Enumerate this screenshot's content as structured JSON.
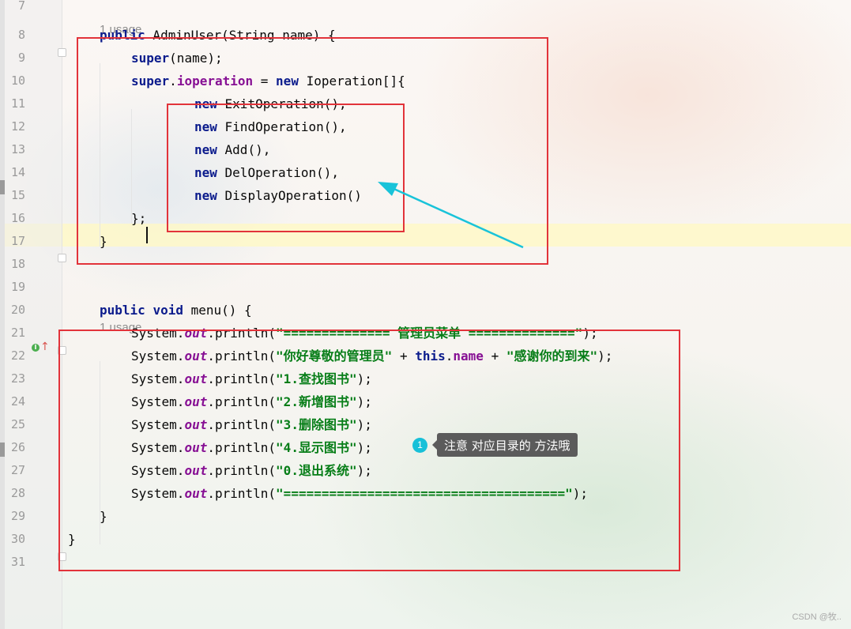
{
  "editor": {
    "usage_hints": [
      "1 usage",
      "1 usage"
    ],
    "lines": [
      {
        "num": "7",
        "tokens": []
      },
      {
        "num": "8",
        "tokens": [
          {
            "t": "public",
            "c": "kw"
          },
          {
            "t": " AdminUser(String name) {"
          }
        ]
      },
      {
        "num": "9",
        "tokens": [
          {
            "t": "super",
            "c": "kw"
          },
          {
            "t": "(name);"
          }
        ]
      },
      {
        "num": "10",
        "tokens": [
          {
            "t": "super",
            "c": "kw"
          },
          {
            "t": "."
          },
          {
            "t": "ioperation",
            "c": "fld"
          },
          {
            "t": " = "
          },
          {
            "t": "new",
            "c": "kw"
          },
          {
            "t": " Ioperation[]{"
          }
        ]
      },
      {
        "num": "11",
        "tokens": [
          {
            "t": "new",
            "c": "kw"
          },
          {
            "t": " ExitOperation(),"
          }
        ]
      },
      {
        "num": "12",
        "tokens": [
          {
            "t": "new",
            "c": "kw"
          },
          {
            "t": " FindOperation(),"
          }
        ]
      },
      {
        "num": "13",
        "tokens": [
          {
            "t": "new",
            "c": "kw"
          },
          {
            "t": " Add(),"
          }
        ]
      },
      {
        "num": "14",
        "tokens": [
          {
            "t": "new",
            "c": "kw"
          },
          {
            "t": " DelOperation(),"
          }
        ]
      },
      {
        "num": "15",
        "tokens": [
          {
            "t": "new",
            "c": "kw"
          },
          {
            "t": " DisplayOperation()"
          }
        ]
      },
      {
        "num": "16",
        "tokens": [
          {
            "t": "};"
          }
        ]
      },
      {
        "num": "17",
        "tokens": [
          {
            "t": "}"
          }
        ]
      },
      {
        "num": "18",
        "tokens": []
      },
      {
        "num": "19",
        "tokens": []
      },
      {
        "num": "20",
        "tokens": [
          {
            "t": "public",
            "c": "kw"
          },
          {
            "t": " "
          },
          {
            "t": "void",
            "c": "kw"
          },
          {
            "t": " menu() {"
          }
        ]
      },
      {
        "num": "21",
        "tokens": [
          {
            "t": "System."
          },
          {
            "t": "out",
            "c": "st"
          },
          {
            "t": ".println("
          },
          {
            "t": "\"============== 管理员菜单 ==============\"",
            "c": "str"
          },
          {
            "t": ");"
          }
        ]
      },
      {
        "num": "22",
        "tokens": [
          {
            "t": "System."
          },
          {
            "t": "out",
            "c": "st"
          },
          {
            "t": ".println("
          },
          {
            "t": "\"你好尊敬的管理员\"",
            "c": "str"
          },
          {
            "t": " + "
          },
          {
            "t": "this",
            "c": "kw"
          },
          {
            "t": "."
          },
          {
            "t": "name",
            "c": "fld"
          },
          {
            "t": " + "
          },
          {
            "t": "\"感谢你的到来\"",
            "c": "str"
          },
          {
            "t": ");"
          }
        ]
      },
      {
        "num": "23",
        "tokens": [
          {
            "t": "System."
          },
          {
            "t": "out",
            "c": "st"
          },
          {
            "t": ".println("
          },
          {
            "t": "\"1.查找图书\"",
            "c": "str"
          },
          {
            "t": ");"
          }
        ]
      },
      {
        "num": "24",
        "tokens": [
          {
            "t": "System."
          },
          {
            "t": "out",
            "c": "st"
          },
          {
            "t": ".println("
          },
          {
            "t": "\"2.新增图书\"",
            "c": "str"
          },
          {
            "t": ");"
          }
        ]
      },
      {
        "num": "25",
        "tokens": [
          {
            "t": "System."
          },
          {
            "t": "out",
            "c": "st"
          },
          {
            "t": ".println("
          },
          {
            "t": "\"3.删除图书\"",
            "c": "str"
          },
          {
            "t": ");"
          }
        ]
      },
      {
        "num": "26",
        "tokens": [
          {
            "t": "System."
          },
          {
            "t": "out",
            "c": "st"
          },
          {
            "t": ".println("
          },
          {
            "t": "\"4.显示图书\"",
            "c": "str"
          },
          {
            "t": ");"
          }
        ]
      },
      {
        "num": "27",
        "tokens": [
          {
            "t": "System."
          },
          {
            "t": "out",
            "c": "st"
          },
          {
            "t": ".println("
          },
          {
            "t": "\"0.退出系统\"",
            "c": "str"
          },
          {
            "t": ");"
          }
        ]
      },
      {
        "num": "28",
        "tokens": [
          {
            "t": "System."
          },
          {
            "t": "out",
            "c": "st"
          },
          {
            "t": ".println("
          },
          {
            "t": "\"=====================================\"",
            "c": "str"
          },
          {
            "t": ");"
          }
        ]
      },
      {
        "num": "29",
        "tokens": [
          {
            "t": "}"
          }
        ]
      },
      {
        "num": "30",
        "tokens": [
          {
            "t": "}"
          }
        ]
      },
      {
        "num": "31",
        "tokens": []
      }
    ]
  },
  "annotation": {
    "number": "1",
    "text": "注意 对应目录的 方法哦",
    "box_color": "#e2333a",
    "arrow_color": "#19c3d9"
  },
  "gutter": {
    "override_icon": "implements-method-icon",
    "override_glyph": "I"
  },
  "watermark": "CSDN @牧.."
}
